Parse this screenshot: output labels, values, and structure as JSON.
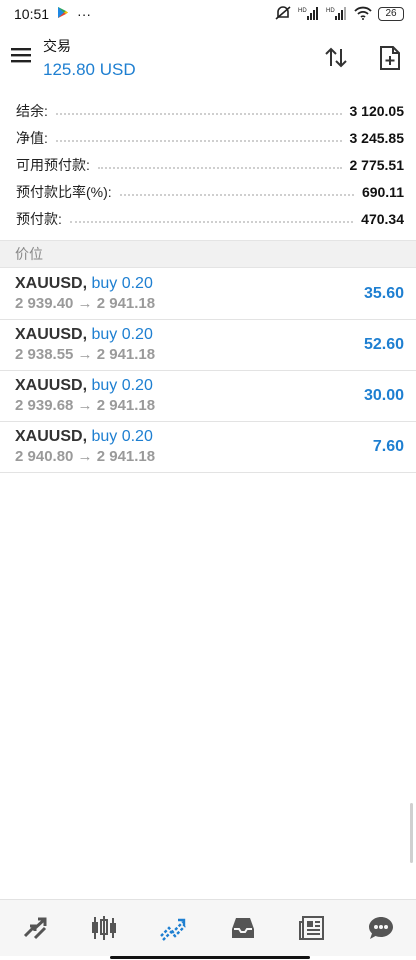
{
  "status_bar": {
    "time": "10:51",
    "more": "···",
    "battery": "26"
  },
  "header": {
    "title": "交易",
    "balance": "125.80 USD"
  },
  "summary": [
    {
      "label": "结余:",
      "value": "3 120.05"
    },
    {
      "label": "净值:",
      "value": "3 245.85"
    },
    {
      "label": "可用预付款:",
      "value": "2 775.51"
    },
    {
      "label": "预付款比率(%):",
      "value": "690.11"
    },
    {
      "label": "预付款:",
      "value": "470.34"
    }
  ],
  "section_title": "价位",
  "positions": [
    {
      "symbol": "XAUUSD",
      "side": "buy 0.20",
      "prices": "2 939.40 → 2 941.18",
      "profit": "35.60"
    },
    {
      "symbol": "XAUUSD",
      "side": "buy 0.20",
      "prices": "2 938.55 → 2 941.18",
      "profit": "52.60"
    },
    {
      "symbol": "XAUUSD",
      "side": "buy 0.20",
      "prices": "2 939.68 → 2 941.18",
      "profit": "30.00"
    },
    {
      "symbol": "XAUUSD",
      "side": "buy 0.20",
      "prices": "2 940.80 → 2 941.18",
      "profit": "7.60"
    }
  ],
  "colors": {
    "accent": "#1e7fd1",
    "muted": "#9a9a9a"
  },
  "bottom_nav": [
    {
      "icon": "quotes-arrows-icon",
      "active": false
    },
    {
      "icon": "candlestick-chart-icon",
      "active": false
    },
    {
      "icon": "trade-trend-icon",
      "active": true
    },
    {
      "icon": "inbox-icon",
      "active": false
    },
    {
      "icon": "news-icon",
      "active": false
    },
    {
      "icon": "chat-bubble-icon",
      "active": false
    }
  ]
}
